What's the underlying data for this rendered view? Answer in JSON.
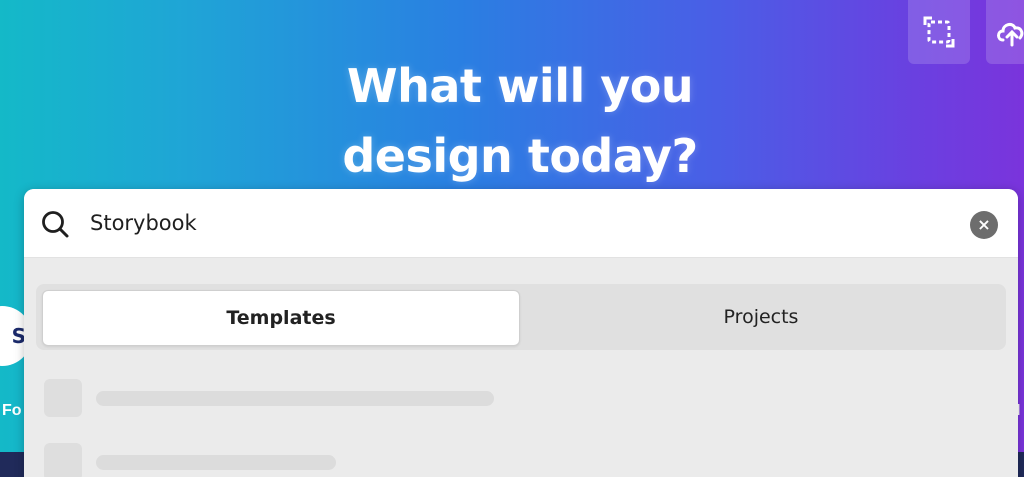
{
  "hero": {
    "line1": "What will you",
    "line2": "design today?"
  },
  "toolbar": {
    "resize_icon": "resize-icon",
    "upload_icon": "cloud-upload-icon"
  },
  "side": {
    "left_label": "Fo",
    "left_circle_glyph": "S"
  },
  "search": {
    "value": "Storybook",
    "clear_icon": "clear-icon",
    "clear_glyph": "×"
  },
  "tabs": [
    {
      "label": "Templates",
      "selected": true
    },
    {
      "label": "Projects",
      "selected": false
    }
  ],
  "colors": {
    "gradient_start": "#14b9c8",
    "gradient_end": "#7a34dc",
    "panel_bg": "#ebebeb"
  }
}
